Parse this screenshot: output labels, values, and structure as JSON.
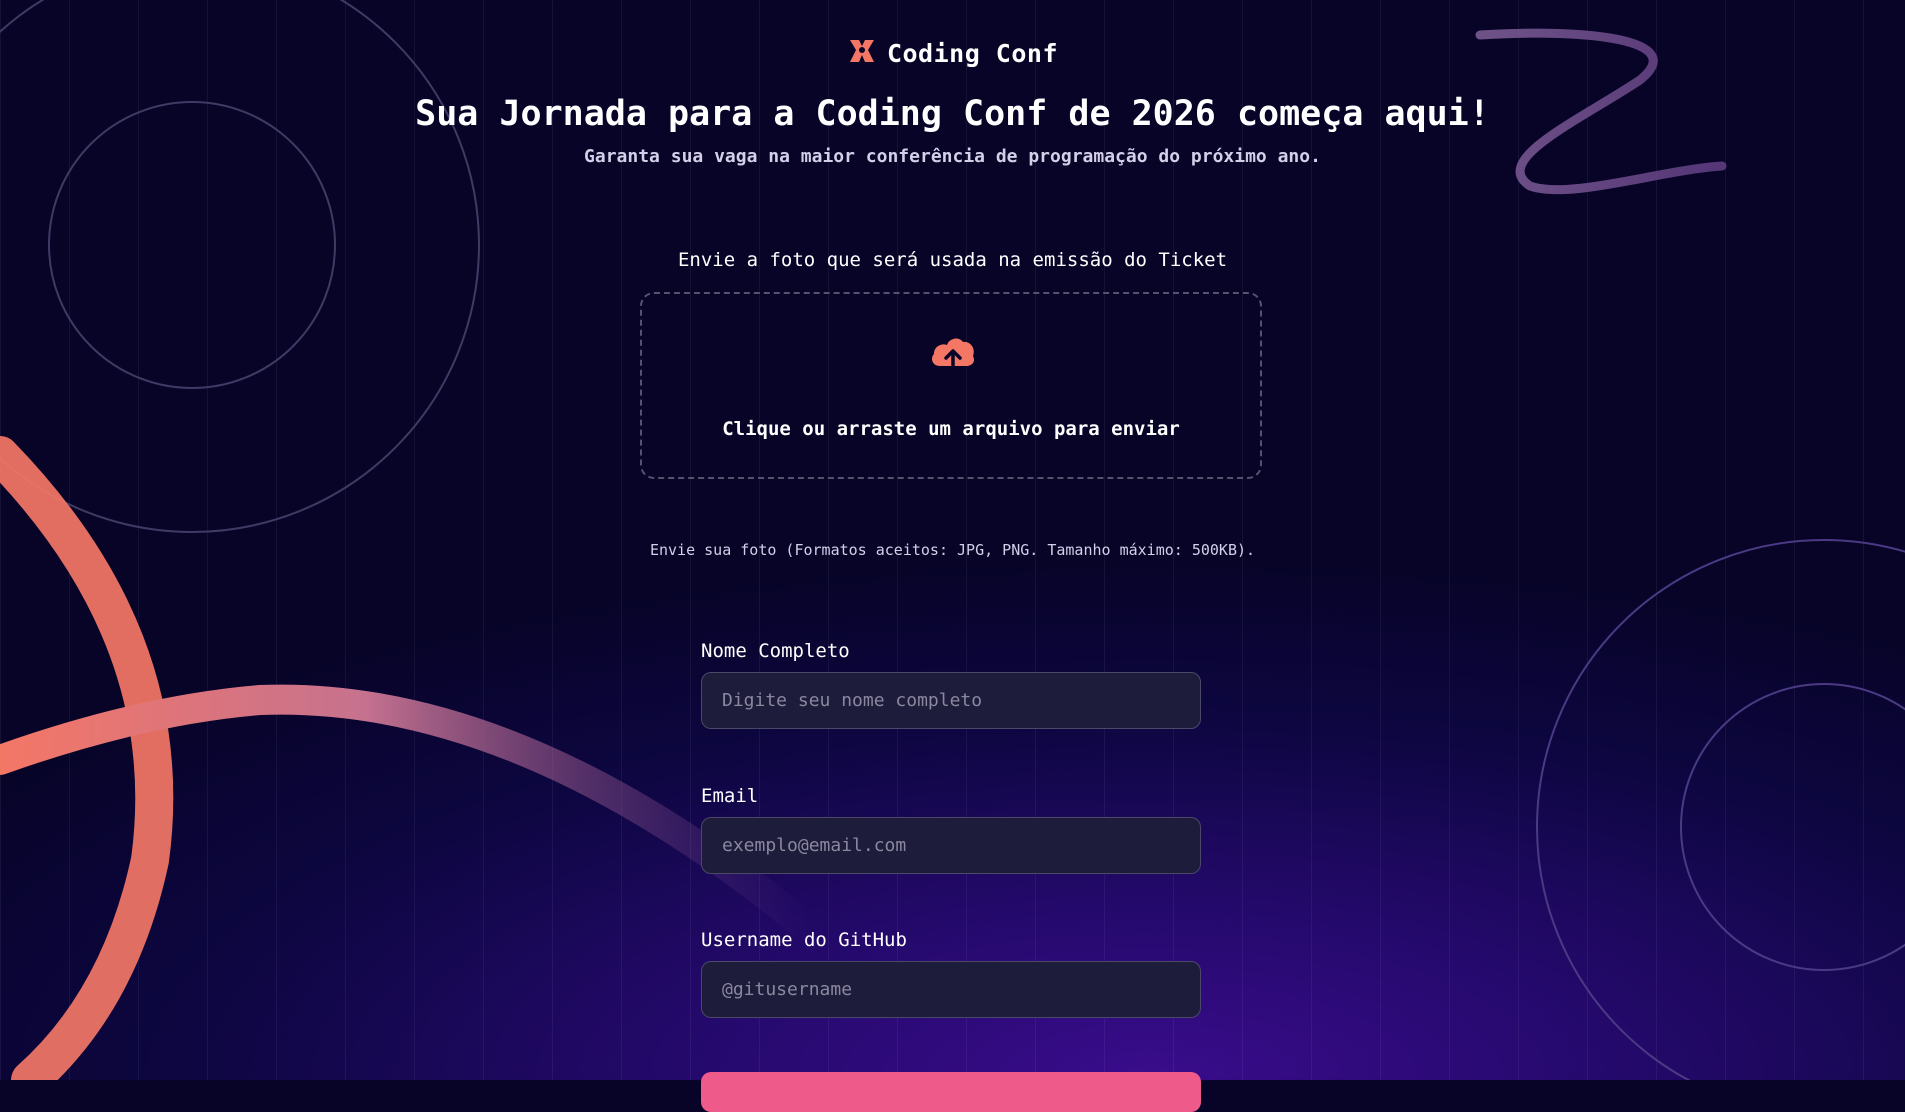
{
  "header": {
    "logo_text": "Coding Conf"
  },
  "hero": {
    "title": "Sua Jornada para a Coding Conf de 2026 começa aqui!",
    "subtitle": "Garanta sua vaga na maior conferência de programação do próximo ano."
  },
  "upload": {
    "label": "Envie a foto que será usada na emissão do Ticket",
    "dropzone_text": "Clique ou arraste um arquivo para enviar",
    "hint": "Envie sua foto (Formatos aceitos: JPG, PNG. Tamanho máximo: 500KB).",
    "icon": "upload-cloud-icon"
  },
  "form": {
    "fields": [
      {
        "label": "Nome Completo",
        "placeholder": "Digite seu nome completo",
        "value": ""
      },
      {
        "label": "Email",
        "placeholder": "exemplo@email.com",
        "value": ""
      },
      {
        "label": "Username do GitHub",
        "placeholder": "@gitusername",
        "value": ""
      }
    ],
    "submit_label": ""
  },
  "colors": {
    "accent": "#f47766",
    "background": "#0d0640",
    "input_bg": "#1d1c3a",
    "button": "#ee5a8a"
  }
}
